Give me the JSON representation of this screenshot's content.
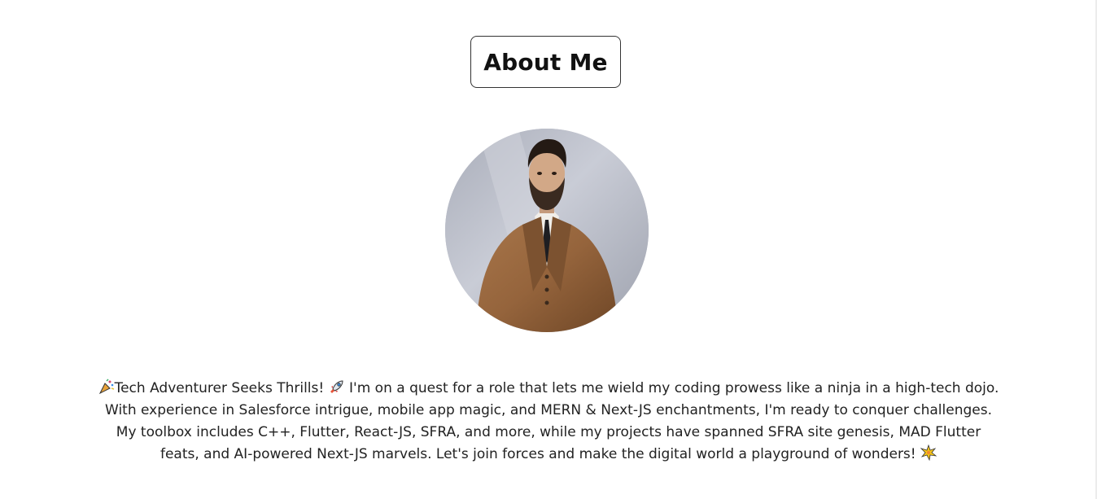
{
  "header": {
    "title": "About Me"
  },
  "profile": {
    "avatar_alt": "profile photo"
  },
  "bio": {
    "line1_a": "Tech Adventurer Seeks Thrills!",
    "line1_b": " I'm on a quest for a role that lets me wield my coding prowess like a ninja in a high-tech dojo.",
    "line2": "With experience in Salesforce intrigue, mobile app magic, and MERN & Next-JS enchantments, I'm ready to conquer challenges.",
    "line3": "My toolbox includes C++, Flutter, React-JS, SFRA, and more, while my projects have spanned SFRA site genesis, MAD Flutter",
    "line4": "feats, and AI-powered Next-JS marvels. Let's join forces and make the digital world a playground of wonders!"
  },
  "icons": {
    "party": "party-popper-icon",
    "rocket": "rocket-icon",
    "sparkle": "sparkle-burst-icon"
  },
  "colors": {
    "background": "#ffffff",
    "text": "#222222",
    "border": "#333333"
  }
}
